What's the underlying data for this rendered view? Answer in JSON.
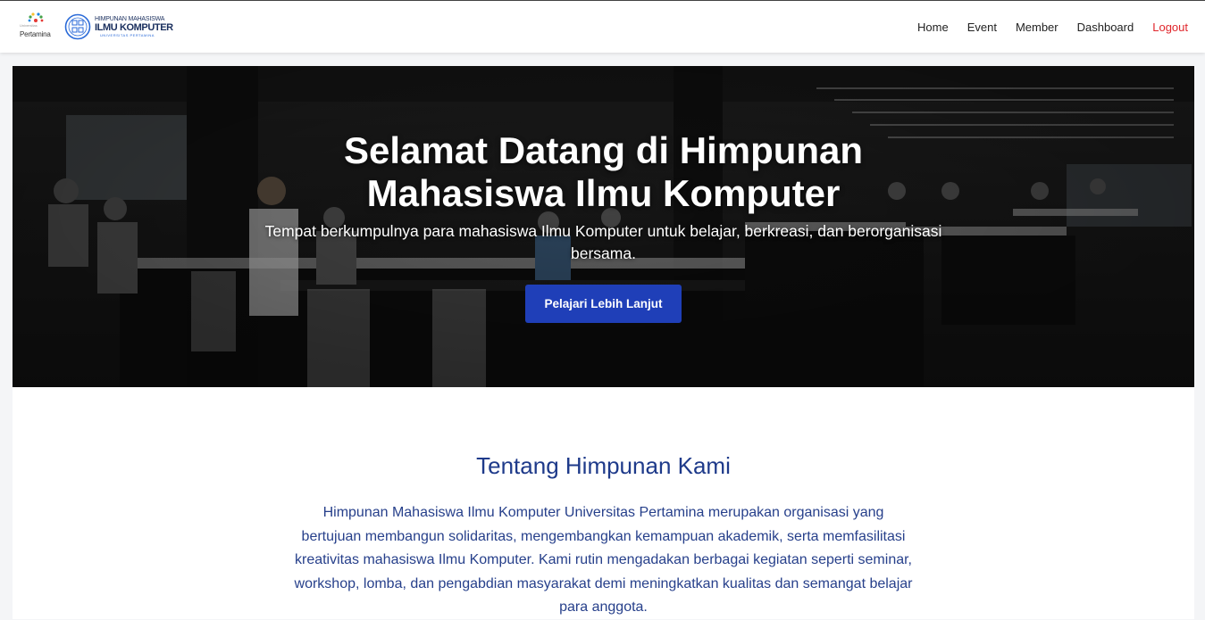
{
  "brand": {
    "pertamina_tagline": "Universitas",
    "pertamina_word": "Pertamina",
    "himakom_line1": "HIMPUNAN MAHASISWA",
    "himakom_line2": "ILMU KOMPUTER",
    "himakom_line3": "UNIVERSITAS PERTAMINA"
  },
  "nav": {
    "home": "Home",
    "event": "Event",
    "member": "Member",
    "dashboard": "Dashboard",
    "logout": "Logout"
  },
  "hero": {
    "title": "Selamat Datang di Himpunan Mahasiswa Ilmu Komputer",
    "subtitle": "Tempat berkumpulnya para mahasiswa Ilmu Komputer untuk belajar, berkreasi, dan berorganisasi bersama.",
    "cta": "Pelajari Lebih Lanjut"
  },
  "about": {
    "title": "Tentang Himpunan Kami",
    "text": "Himpunan Mahasiswa Ilmu Komputer Universitas Pertamina merupakan organisasi yang bertujuan membangun solidaritas, mengembangkan kemampuan akademik, serta memfasilitasi kreativitas mahasiswa Ilmu Komputer. Kami rutin mengadakan berbagai kegiatan seperti seminar, workshop, lomba, dan pengabdian masyarakat demi meningkatkan kualitas dan semangat belajar para anggota."
  },
  "colors": {
    "primary": "#1f3fb8",
    "heading": "#1e3a8a",
    "logout": "#e0262c"
  }
}
